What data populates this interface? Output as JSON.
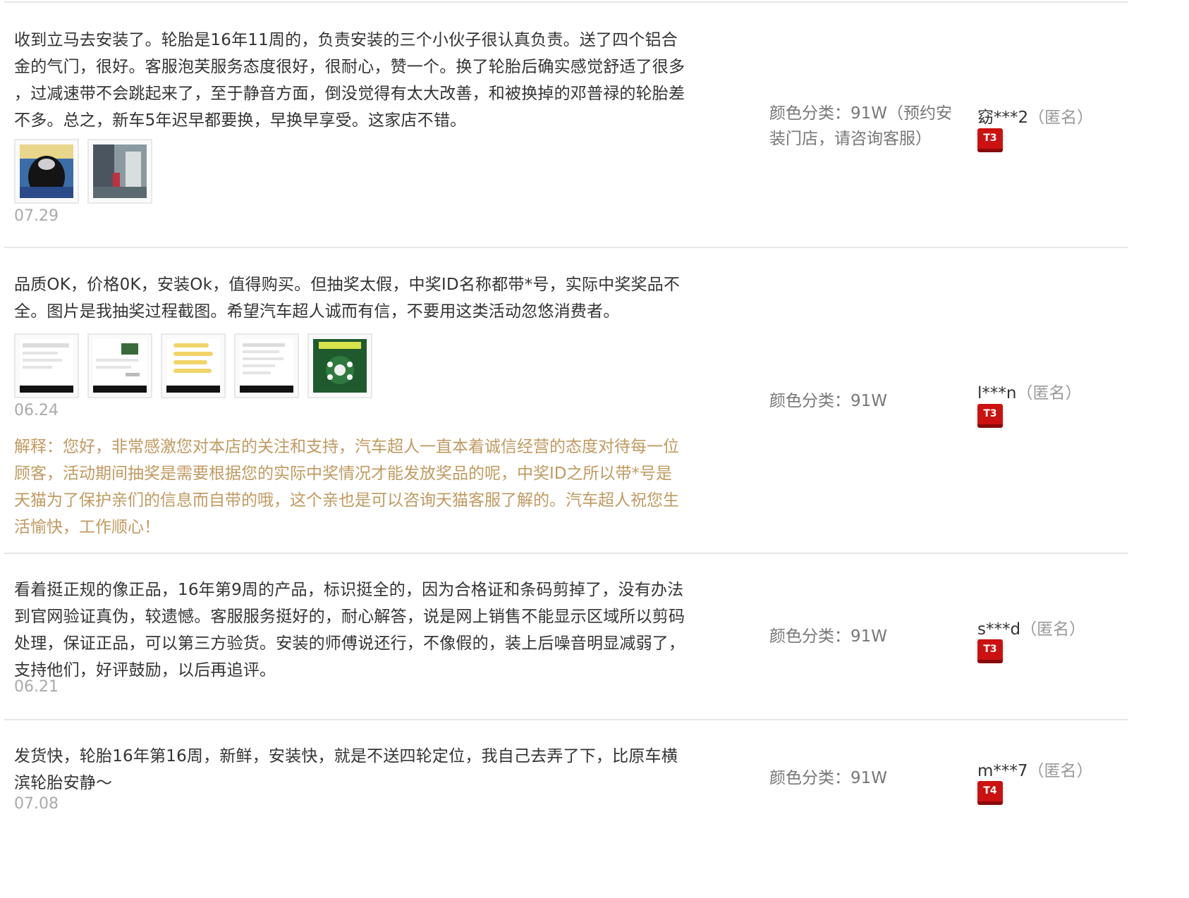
{
  "reviews": [
    {
      "content": "收到立马去安装了。轮胎是16年11周的，负责安装的三个小伙子很认真负责。送了四个铝合\n金的气门，很好。客服泡芙服务态度很好，很耐心，赞一个。换了轮胎后确实感觉舒适了很多\n，过减速带不会跳起来了，至于静音方面，倒没觉得有太大改善，和被换掉的邓普禄的轮胎差\n不多。总之，新车5年迟早都要换，早换早享受。这家店不错。",
      "photos": [
        "photo-tire",
        "photo-shop"
      ],
      "date": "07.29",
      "reply": "",
      "sku": "颜色分类：91W（预约安\n装门店，请咨询客服）",
      "user_name": "窈***2",
      "user_anon": "（匿名）",
      "badge": "T3"
    },
    {
      "content": "品质OK，价格0K，安装Ok，值得购买。但抽奖太假，中奖ID名称都带*号，实际中奖奖品不\n全。图片是我抽奖过程截图。希望汽车超人诚而有信，不要用这类活动忽悠消费者。",
      "photos": [
        "screenshot-1",
        "screenshot-2",
        "screenshot-3",
        "screenshot-4",
        "screenshot-5"
      ],
      "date": "06.24",
      "reply": "解释：您好，非常感激您对本店的关注和支持，汽车超人一直本着诚信经营的态度对待每一位\n顾客，活动期间抽奖是需要根据您的实际中奖情况才能发放奖品的呢，中奖ID之所以带*号是\n天猫为了保护亲们的信息而自带的哦，这个亲也是可以咨询天猫客服了解的。汽车超人祝您生\n活愉快，工作顺心！",
      "sku": "颜色分类：91W",
      "user_name": "l***n",
      "user_anon": "（匿名）",
      "badge": "T3"
    },
    {
      "content": "看着挺正规的像正品，16年第9周的产品，标识挺全的，因为合格证和条码剪掉了，没有办法\n到官网验证真伪，较遗憾。客服服务挺好的，耐心解答，说是网上销售不能显示区域所以剪码\n处理，保证正品，可以第三方验货。安装的师傅说还行，不像假的，装上后噪音明显减弱了，\n支持他们，好评鼓励，以后再追评。",
      "photos": [],
      "date": "06.21",
      "reply": "",
      "sku": "颜色分类：91W",
      "user_name": "s***d",
      "user_anon": "（匿名）",
      "badge": "T3"
    },
    {
      "content": "发货快，轮胎16年第16周，新鲜，安装快，就是不送四轮定位，我自己去弄了下，比原车横\n滨轮胎安静～",
      "photos": [],
      "date": "07.08",
      "reply": "",
      "sku": "颜色分类：91W",
      "user_name": "m***7",
      "user_anon": "（匿名）",
      "badge": "T4"
    }
  ]
}
